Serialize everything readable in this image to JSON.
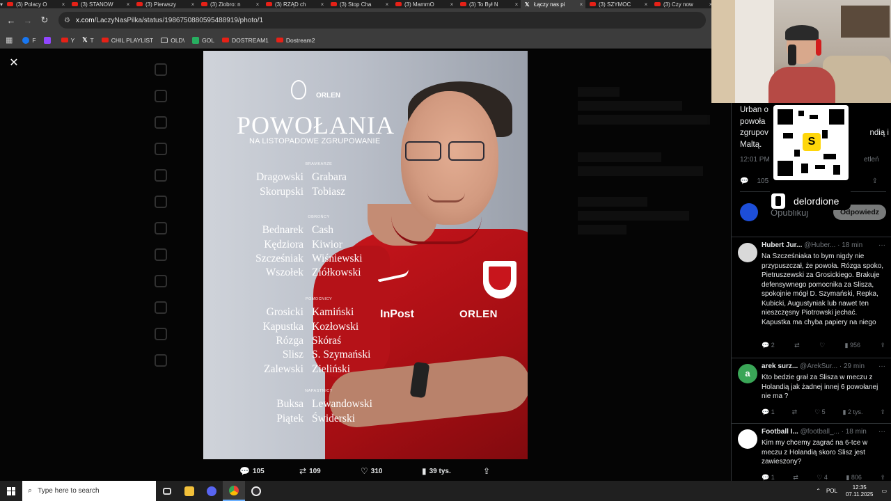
{
  "browser": {
    "tabs": [
      {
        "label": "(3) Polacy O",
        "icon": "youtube-icon"
      },
      {
        "label": "(3) STANOW",
        "icon": "youtube-icon"
      },
      {
        "label": "(3) Pierwszy",
        "icon": "youtube-icon"
      },
      {
        "label": "(3) Ziobro: n",
        "icon": "youtube-icon"
      },
      {
        "label": "(3) RZĄD ch",
        "icon": "youtube-icon"
      },
      {
        "label": "(3) Stop Cha",
        "icon": "youtube-icon"
      },
      {
        "label": "(3) MammO",
        "icon": "youtube-icon"
      },
      {
        "label": "(3) To Był N",
        "icon": "youtube-icon"
      },
      {
        "label": "Łączy nas pi",
        "icon": "x-icon",
        "active": true
      },
      {
        "label": "(3) SZYMOC",
        "icon": "youtube-icon"
      },
      {
        "label": "(3) Czy now",
        "icon": "youtube-icon"
      }
    ],
    "url_domain": "x.com",
    "url_path": "/LaczyNasPilka/status/1986750880595488919/photo/1",
    "bookmarks": [
      {
        "label": "F",
        "icon": "facebook-icon"
      },
      {
        "label": "",
        "icon": "twitch-icon"
      },
      {
        "label": "Y",
        "icon": "youtube-icon"
      },
      {
        "label": "T",
        "icon": "x-icon"
      },
      {
        "label": "CHIL PLAYLIST",
        "icon": "youtube-icon"
      },
      {
        "label": "OLD\\",
        "icon": "folder-icon"
      },
      {
        "label": "GOL",
        "icon": "gol-icon"
      },
      {
        "label": "DOSTREAM1",
        "icon": "youtube-icon"
      },
      {
        "label": "Dostream2",
        "icon": "youtube-icon"
      }
    ]
  },
  "poster": {
    "title": "POWOŁANIA",
    "subtitle": "NA LISTOPADOWE ZGRUPOWANIE",
    "sections": [
      {
        "label": "BRAMKARZE",
        "rows": [
          [
            "Dragowski",
            "Grabara"
          ],
          [
            "Skorupski",
            "Tobiasz"
          ]
        ]
      },
      {
        "label": "OBROŃCY",
        "rows": [
          [
            "Bednarek",
            "Cash"
          ],
          [
            "Kędziora",
            "Kiwior"
          ],
          [
            "Szcześniak",
            "Wiśniewski"
          ],
          [
            "Wszołek",
            "Ziółkowski"
          ]
        ]
      },
      {
        "label": "POMOCNICY",
        "rows": [
          [
            "Grosicki",
            "Kamiński"
          ],
          [
            "Kapustka",
            "Kozłowski"
          ],
          [
            "Rózga",
            "Skóraś"
          ],
          [
            "Slisz",
            "S. Szymański"
          ],
          [
            "Zalewski",
            "Zieliński"
          ]
        ]
      },
      {
        "label": "NAPASTNICY",
        "rows": [
          [
            "Buksa",
            "Lewandowski"
          ],
          [
            "Piątek",
            "Świderski"
          ]
        ]
      }
    ],
    "logo_text": "ORLEN",
    "shirt_sponsor_1": "InPost",
    "shirt_sponsor_2": "ORLEN"
  },
  "post_actions": {
    "replies": "105",
    "reposts": "109",
    "likes": "310",
    "views": "39 tys."
  },
  "sidebar": {
    "tweet_lines": [
      "Urban o",
      "powoła",
      "zgrupov",
      "Maltą."
    ],
    "tweet_right": "ndią i",
    "time": "12:01 PM",
    "views_suffix": "etleń",
    "stats": {
      "replies": "105"
    },
    "reply_placeholder": "Opublikuj",
    "reply_button": "Odpowiedz",
    "streamer_name": "delordione",
    "qr_center": "S",
    "replies": [
      {
        "name": "Hubert Jur...",
        "handle": "@Huber...",
        "age": "· 18 min",
        "text": "Na Szcześniaka to bym nigdy nie przypuszczał, że powoła. Rózga spoko, Pietruszewski za Grosickiego. Brakuje defensywnego pomocnika za Slisza, spokojnie mógł D. Szymański, Repka, Kubicki, Augustyniak lub nawet ten nieszczęsny Piotrowski jechać. Kapustka ma chyba papiery na niego",
        "replies": "2",
        "reposts": "",
        "likes": "",
        "views": "956"
      },
      {
        "name": "arek surz...",
        "handle": "@ArekSur...",
        "age": "· 29 min",
        "avatar_letter": "a",
        "text": "Kto bedzie grał za Slisza w meczu z Holandią jak żadnej innej 6 powołanej nie ma ?",
        "replies": "1",
        "reposts": "",
        "likes": "5",
        "views": "2 tys."
      },
      {
        "name": "Football I...",
        "handle": "@football_...",
        "age": "· 18 min",
        "text": "Kim my chcemy zagrać na 6-tce w meczu z Holandią skoro Slisz jest zawieszony?",
        "replies": "1",
        "reposts": "",
        "likes": "4",
        "views": "806"
      }
    ]
  },
  "taskbar": {
    "search_placeholder": "Type here to search",
    "language": "POL",
    "time": "12:35",
    "date": "07.11.2025"
  },
  "colors": {
    "shirt_red": "#c8151c",
    "x_background": "#000000",
    "youtube_red": "#e62117",
    "accent_blue": "#1d9bf0"
  }
}
